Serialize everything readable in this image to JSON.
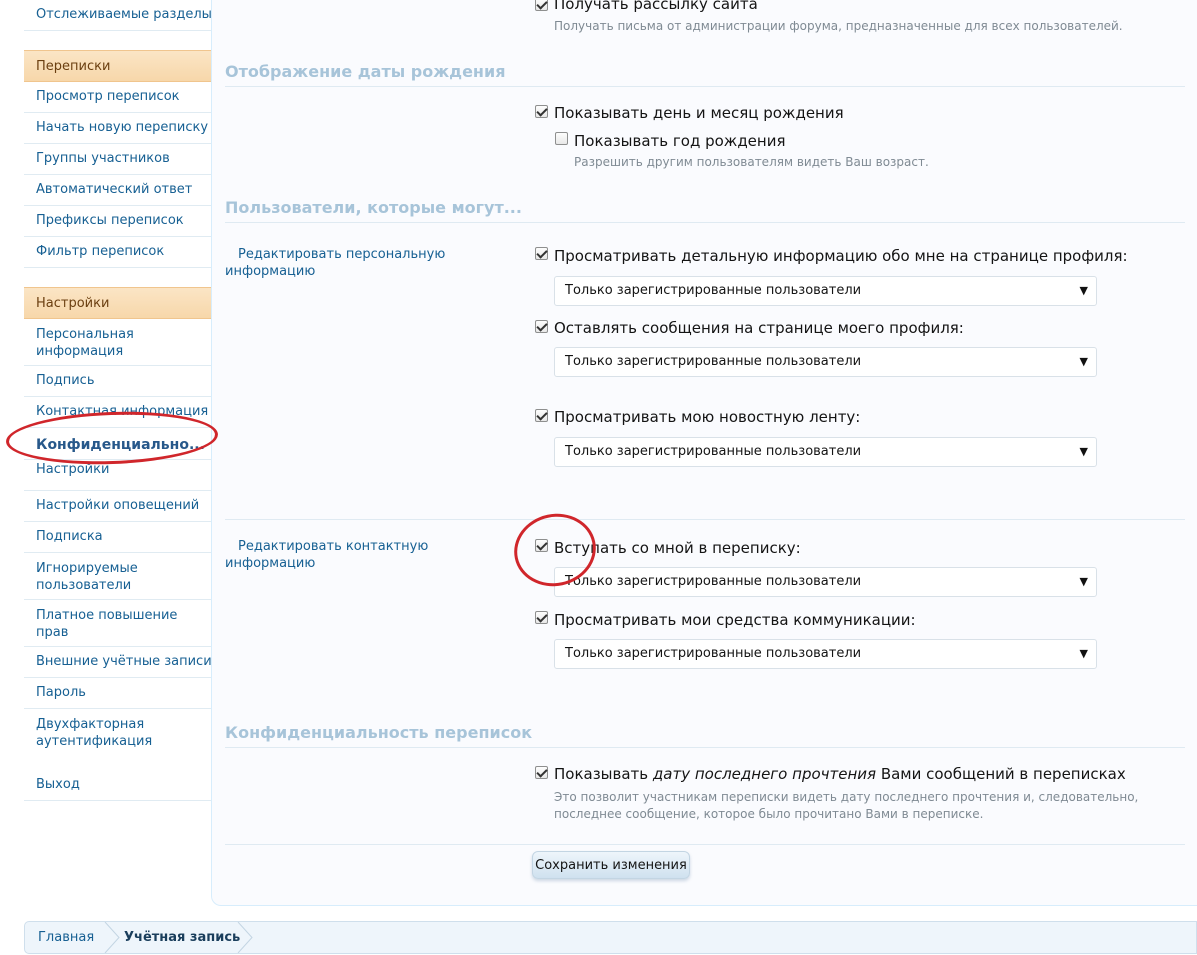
{
  "sidebar": {
    "top_item": "Отслеживаемые разделы",
    "conversations": {
      "heading": "Переписки",
      "items": [
        "Просмотр переписок",
        "Начать новую переписку",
        "Группы участников",
        "Автоматический ответ",
        "Префиксы переписок",
        "Фильтр переписок"
      ]
    },
    "settings": {
      "heading": "Настройки",
      "items": [
        "Персональная информация",
        "Подпись",
        "Контактная информация",
        "Конфиденциально...",
        "Настройки",
        "Настройки оповещений",
        "Подписка",
        "Игнорируемые пользователи",
        "Платное повышение прав",
        "Внешние учётные записи",
        "Пароль",
        "Двухфакторная аутентификация"
      ],
      "active_index": 3
    },
    "logout": "Выход"
  },
  "newsletter": {
    "label": "Получать рассылку сайта",
    "checked": true,
    "hint": "Получать письма от администрации форума, предназначенные для всех пользователей."
  },
  "birthday": {
    "title": "Отображение даты рождения",
    "show_day_month": {
      "label": "Показывать день и месяц рождения",
      "checked": true
    },
    "show_year": {
      "label": "Показывать год рождения",
      "checked": false
    },
    "hint": "Разрешить другим пользователям видеть Ваш возраст."
  },
  "users_who_can": {
    "title": "Пользователи, которые могут...",
    "personal_label": "Редактировать персональную информацию",
    "contact_label": "Редактировать контактную информацию",
    "view_profile_details": {
      "label": "Просматривать детальную информацию обо мне на странице профиля:",
      "checked": true,
      "value": "Только зарегистрированные пользователи"
    },
    "post_on_profile": {
      "label": "Оставлять сообщения на странице моего профиля:",
      "checked": true,
      "value": "Только зарегистрированные пользователи"
    },
    "view_news_feed": {
      "label": "Просматривать мою новостную ленту:",
      "checked": true,
      "value": "Только зарегистрированные пользователи"
    },
    "start_conversation": {
      "label": "Вступать со мной в переписку:",
      "checked": true,
      "value": "Только зарегистрированные пользователи"
    },
    "view_identities": {
      "label": "Просматривать мои средства коммуникации:",
      "checked": true,
      "value": "Только зарегистрированные пользователи"
    }
  },
  "conversation_privacy": {
    "title": "Конфиденциальность переписок",
    "label_before": "Показывать ",
    "label_emphasis": "дату последнего прочтения",
    "label_after": " Вами сообщений в переписках",
    "checked": true,
    "hint_line1": "Это позволит участникам переписки видеть дату последнего прочтения и, следовательно,",
    "hint_line2": "последнее сообщение, которое было прочитано Вами в переписке."
  },
  "save_label": "Сохранить изменения",
  "breadcrumb": {
    "home": "Главная",
    "current": "Учётная запись"
  },
  "colors": {
    "link": "#176093",
    "section_title": "#a7c4d9",
    "nav_heading_bg": "#f7d7aa",
    "annotation_red": "#d0262b"
  },
  "icons": {
    "select_arrow": "▼"
  }
}
